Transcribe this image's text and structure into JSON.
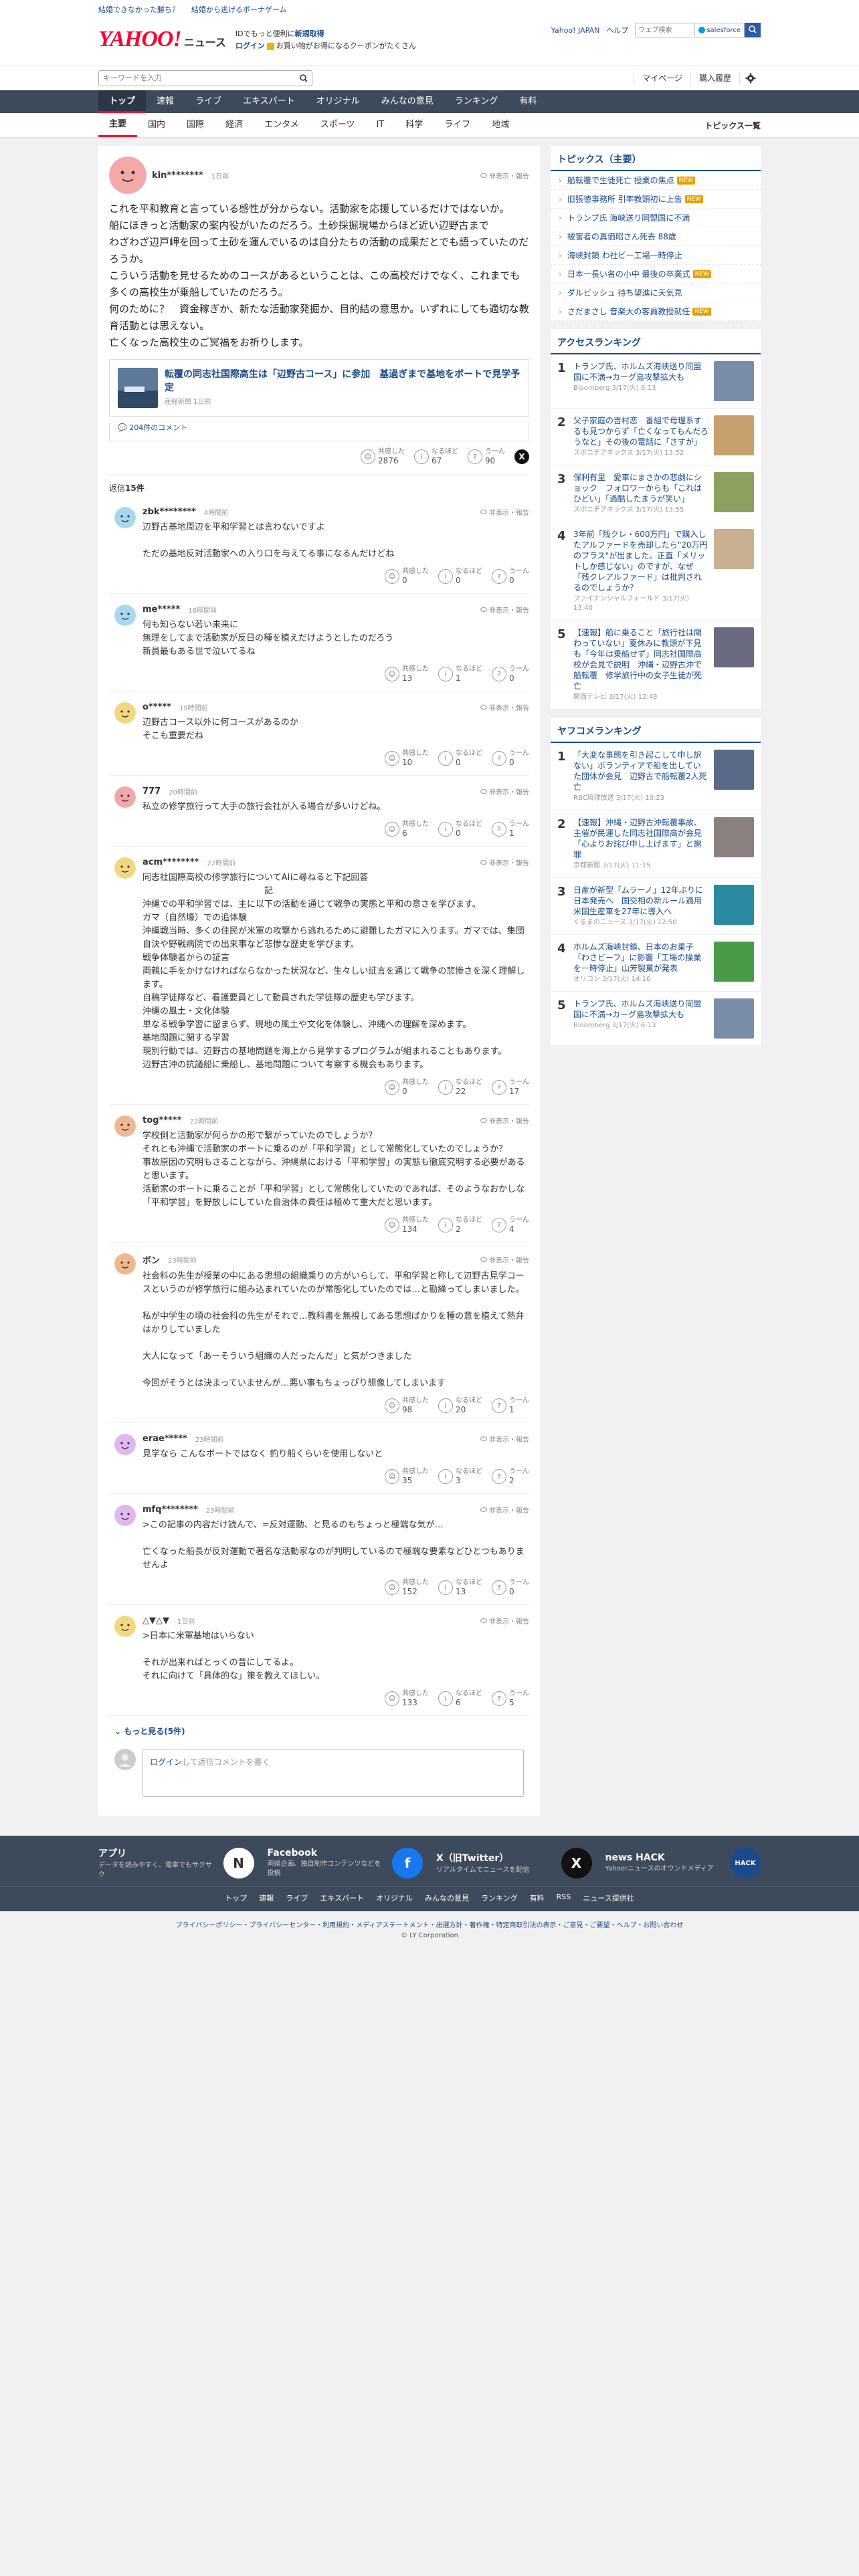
{
  "promo": {
    "link1": "結婚できなかった勝ち？",
    "link2": "結婚から逃げるボーナゲーム"
  },
  "masthead": {
    "logo": "YAHOO!",
    "logo_sub": "JAPAN",
    "section": "ニュース",
    "app_line1": "ID",
    "app_line1b": "でもっと便利に",
    "app_line1c": "新規取得",
    "login": "ログイン",
    "coupon_text": "お買い物がお得になるクーポンがたくさん",
    "links": [
      "Yahoo! JAPAN",
      "ヘルプ"
    ],
    "web_search_placeholder": "ウェブ検索",
    "salesforce": "salesforce"
  },
  "subbar": {
    "keyword_placeholder": "キーワードを入力",
    "mypage": "マイページ",
    "history": "購入履歴"
  },
  "gnav": [
    "トップ",
    "速報",
    "ライブ",
    "エキスパート",
    "オリジナル",
    "みんなの意見",
    "ランキング",
    "有料"
  ],
  "cnav": [
    "主要",
    "国内",
    "国際",
    "経済",
    "エンタメ",
    "スポーツ",
    "IT",
    "科学",
    "ライフ",
    "地域"
  ],
  "cnav_more": "トピックス一覧",
  "comment": {
    "user": "kin********",
    "time": "1日前",
    "hide_label": "非表示・報告",
    "text": "これを平和教育と言っている感性が分からない。活動家を応援しているだけではないか。\n船にほきっと活動家の案内役がいたのだろう。土砂採掘現場からほど近い辺野古まで\nわざわざ辺戸岬を回って土砂を運んでいるのは自分たちの活動の成果だとでも語っていたのだろうか。\nこういう活動を見せるためのコースがあるということは、この高校だけでなく、これまでも多くの高校生が乗船していたのだろう。\n何のために？　資金稼ぎか、新たな活動家発掘か、目的結の意思か。いずれにしても適切な教育活動とは思えない。\n亡くなった高校生のご冥福をお祈りします。",
    "article": {
      "title": "転覆の同志社国際高生は「辺野古コース」に参加　基過ぎまで基地をボートで見学予定",
      "meta": "産経新聞 1日前",
      "count": "204件のコメント"
    },
    "reactions": [
      {
        "label": "共感した",
        "n": "2876"
      },
      {
        "label": "なるほど",
        "n": "67"
      },
      {
        "label": "うーん",
        "n": "90"
      }
    ],
    "reply_count_label": "返信",
    "reply_count": "15件"
  },
  "replies": [
    {
      "user": "zbk********",
      "time": "4時間前",
      "color": "#a8d8f0",
      "text": "辺野古基地周辺を平和学習とは言わないですよ\n\nただの基地反対活動家への入り口を与えてる事になるんだけどね",
      "r": [
        "0",
        "0",
        "0"
      ]
    },
    {
      "user": "me*****",
      "time": "18時間前",
      "color": "#a8d8f0",
      "text": "何も知らない若い未来に\n無理をしてまで活動家が反日の種を植えだけようとしたのだろう\n新員最もある世で泣いてるね",
      "r": [
        "13",
        "1",
        "0"
      ]
    },
    {
      "user": "o*****",
      "time": "19時間前",
      "color": "#f0d880",
      "text": "辺野古コース以外に何コースがあるのか\nそこも重要だね",
      "r": [
        "10",
        "0",
        "0"
      ]
    },
    {
      "user": "777",
      "time": "20時間前",
      "color": "#f0a8a8",
      "text": "私立の修学旅行って大手の旅行会社が入る場合が多いけどね。",
      "r": [
        "6",
        "0",
        "1"
      ]
    },
    {
      "user": "acm********",
      "time": "22時間前",
      "color": "#f0d880",
      "text": "同志社国際高校の修学旅行についてAIに尋ねると下記回答\n　　　　　　　　　　　　　　記\n沖縄での平和学習では、主に以下の活動を通じて戦争の実態と平和の意さを学びます。\nガマ（自然壕）での追体験\n沖縄戦当時、多くの住民が米軍の攻撃から逃れるために避難したガマに入ります。ガマでは、集団自決や野戦病院での出来事など悲惨な歴史を学びます。\n戦争体験者からの証言\n両親に手をかけなければならなかった状況など、生々しい証言を通じて戦争の悲惨さを深く理解します。\n自稿学徒隊など、看護要員として動員された学徒隊の歴史も学びます。\n沖縄の風土・文化体験\n単なる戦争学習に留まらず、現地の風土や文化を体験し、沖縄への理解を深めます。\n基地問題に関する学習\n現別行動では、辺野古の基地問題を海上から見学するプログラムが組まれることもあります。\n辺野古沖の抗議船に乗船し、基地問題について考察する機会もあります。",
      "r": [
        "0",
        "22",
        "17"
      ]
    },
    {
      "user": "tog*****",
      "time": "22時間前",
      "color": "#f0b890",
      "text": "学校側と活動家が何らかの形で繋がっていたのでしょうか？\nそれとも沖縄で活動家のボートに乗るのが「平和学習」として常態化していたのでしょうか？\n事故原因の究明もさることながら、沖縄県における「平和学習」の実態も徹底究明する必要があると思います。\n活動家のボートに乗ることが「平和学習」として常態化していたのであれば、そのようなおかしな「平和学習」を野放しにしていた自治体の責任は極めて重大だと思います。",
      "r": [
        "134",
        "2",
        "4"
      ]
    },
    {
      "user": "ボン",
      "time": "23時間前",
      "color": "#f0b890",
      "text": "社会科の先生が授業の中にある思想の組織乗りの方がいらして、平和学習と称して辺野古見学コースというのが修学旅行に組み込まれていたのが常態化していたのでは…と勘繰ってしまいました。\n\n私が中学生の頃の社会科の先生がそれで…教科書を無視してある思想ばかりを種の意を植えて熱弁はかりしていました\n\n大人になって「あーそういう組織の人だったんだ」と気がつきました\n\n今回がそうとは決まっていませんが…悪い事もちょっぴり想像してしまいます",
      "r": [
        "98",
        "20",
        "1"
      ]
    },
    {
      "user": "erae*****",
      "time": "23時間前",
      "color": "#e0b8f0",
      "text": "見学なら こんなボートではなく 釣り船くらいを使用しないと",
      "r": [
        "35",
        "3",
        "2"
      ]
    },
    {
      "user": "mfq********",
      "time": "23時間前",
      "color": "#e0b8f0",
      "text": ">この記事の内容だけ読んで、=反対運動、と見るのもちょっと極端な気が…\n\n亡くなった船長が反対運動で著名な活動家なのが判明しているので極端な要素などひとつもありませんよ",
      "r": [
        "152",
        "13",
        "0"
      ]
    },
    {
      "user": "△▼△▼",
      "time": "1日前",
      "color": "#f0d880",
      "text": ">日本に米軍基地はいらない\n\nそれが出来ればとっくの昔にしてるよ。\nそれに向けて「具体的な」策を教えてほしい。",
      "r": [
        "133",
        "6",
        "5"
      ]
    }
  ],
  "more": {
    "label": "もっと見る",
    "count": "(5件)"
  },
  "reply_form": {
    "login": "ログイン",
    "placeholder": "して返信コメントを書く"
  },
  "side": {
    "topics_title": "トピックス（主要）",
    "topics": [
      {
        "t": "船転覆で生徒死亡 授業の焦点",
        "b": "NEW"
      },
      {
        "t": "旧張徳事務所 引率教頭初に上告",
        "b": "NEW"
      },
      {
        "t": "トランプ氏 海峡送り同盟国に不満",
        "b": ""
      },
      {
        "t": "被害者の真価昭さん死去 88歳",
        "b": ""
      },
      {
        "t": "海峡封鎖 わ社ビー工場一時停止",
        "b": ""
      },
      {
        "t": "日本一長い名の小中 最後の卒業式",
        "b": "NEW"
      },
      {
        "t": "ダルビッシュ 待ち望進に天気見",
        "b": ""
      },
      {
        "t": "さだまさし 音楽大の客員教授就任",
        "b": "NEW"
      }
    ],
    "access_title": "アクセスランキング",
    "access": [
      {
        "t": "トランプ氏、ホルムズ海峡送り同盟国に不満→カーグ島攻撃拡大も",
        "m": "Bloomberg 3/17(火) 6:13",
        "c": "#7a8da8"
      },
      {
        "t": "父子家庭の吉村恋　番組で母理系するも見つからず「亡くなってもんだろうなと」その後の電話に「さすが」",
        "m": "スポニチアネックス 3/17(火) 13:52",
        "c": "#c8a070"
      },
      {
        "t": "保利有里　愛車にまさかの悲劇にショック　フォロワーからも「これはひどい」「過酷したまうが笑い」",
        "m": "スポニチアネックス 3/17(火) 13:55",
        "c": "#8ca060"
      },
      {
        "t": "3年前「残クレ・600万円」で購入したアルファードを売却したら\"20万円のプラス\"が出ました。正直「メリットしか感じない」のですが、なぜ「残クレアルファード」は批判されるのでしょうか？",
        "m": "ファイナンシャルフィールド 3/17(火) 13:40",
        "c": "#c8b090"
      },
      {
        "t": "【速報】船に乗ること「旅行社は関わっていない」夏休みに教頭が下見も「今年は乗船せず」同志社国際高校が会見で説明　沖縄・辺野古沖で船転覆　修学旅行中の女子生徒が死亡",
        "m": "関西テレビ 3/17(火) 12:48",
        "c": "#6a6a80"
      }
    ],
    "yahoo_title": "ヤフコメランキング",
    "yahoo": [
      {
        "t": "「大変な事態を引き起こして申し訳ない」ボランティアで船を出していた団体が会見　辺野古で船転覆2人死亡",
        "m": "RBC琉球放送 3/17(火) 10:23",
        "c": "#5a6a88"
      },
      {
        "t": "【速報】沖縄・辺野古沖転覆事故、主催が民運した同志社国際高が会見「心よりお詫び申し上げます」と謝罪",
        "m": "京都新聞 3/17(火) 11:15",
        "c": "#8a8080"
      },
      {
        "t": "日産が新型「ムラーノ」12年ぶりに日本発売へ　国交相の新ルール適用　米国生産車を27年に導入へ",
        "m": "くるまのニュース 3/17(火) 12:50",
        "c": "#2a8aa0"
      },
      {
        "t": "ホルムズ海峡封鎖、日本のお菓子「わさビーフ」に影響「工場の操業を一時停止」山芳製菓が発表",
        "m": "オリコン 3/17(火) 14:16",
        "c": "#4a9a4a"
      },
      {
        "t": "トランプ氏、ホルムズ海峡送り同盟国に不満→カーグ島攻撃拡大も",
        "m": "Bloomberg 3/17(火) 6:13",
        "c": "#7a8da8"
      }
    ]
  },
  "footer": {
    "apps": [
      {
        "n": "アプリ",
        "d": "データを読みやすく、電車でもサクサク",
        "icon": "N",
        "bg": "#ffffff",
        "fg": "#333"
      },
      {
        "n": "Facebook",
        "d": "両県企画、独自制作コンテンツなどを投稿",
        "icon": "f",
        "bg": "#1877f2",
        "fg": "#fff"
      },
      {
        "n": "X（旧Twitter）",
        "d": "リアルタイムでニュースを配信",
        "icon": "X",
        "bg": "#111111",
        "fg": "#fff"
      },
      {
        "n": "news HACK",
        "d": "Yahoo!ニュースのオウンドメディア",
        "icon": "HACK",
        "bg": "#1a4a8c",
        "fg": "#fff"
      }
    ],
    "nav": [
      "トップ",
      "速報",
      "ライブ",
      "エキスパート",
      "オリジナル",
      "みんなの意見",
      "ランキング",
      "有料",
      "RSS",
      "ニュース提供社"
    ],
    "legal": "プライバシーポリシー・プライバシーセンター・利用規約・メディアステートメント・出選方針・著作権・特定商取引法の表示・ご意見・ご要望・ヘルプ・お問い合わせ",
    "copy": "© LY Corporation"
  }
}
